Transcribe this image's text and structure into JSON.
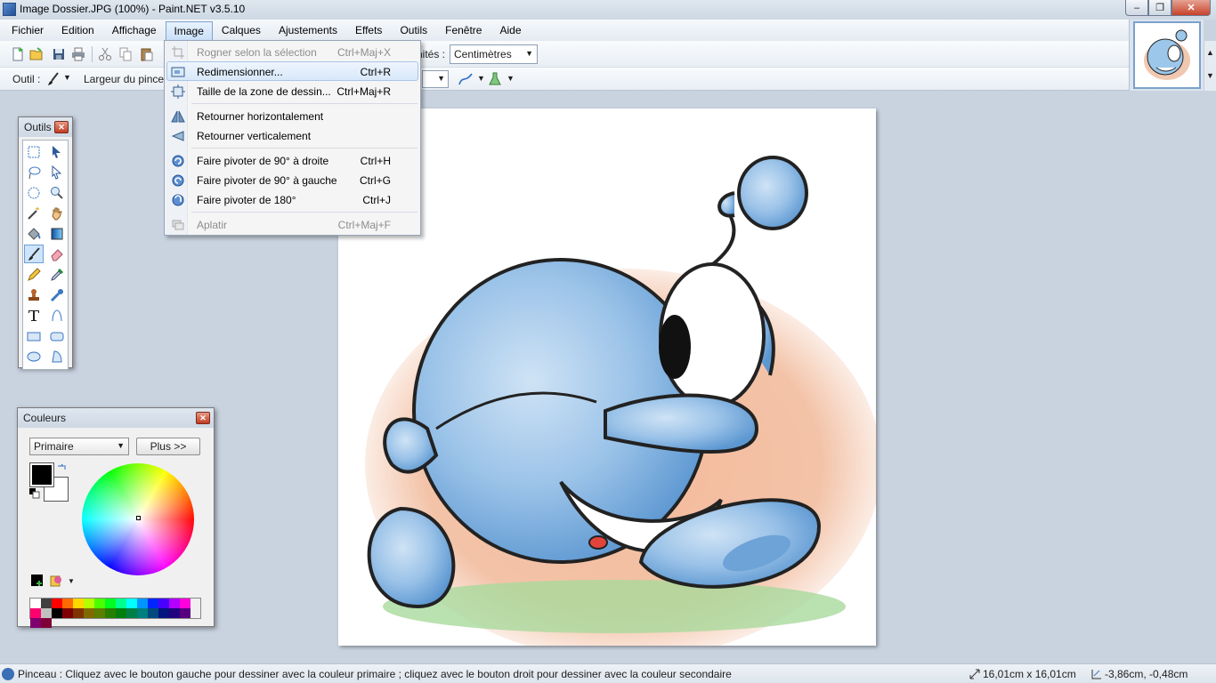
{
  "window": {
    "title": "Image Dossier.JPG (100%) - Paint.NET v3.5.10",
    "minimize_glyph": "–",
    "maximize_glyph": "❐",
    "close_glyph": "✕"
  },
  "menubar": [
    "Fichier",
    "Edition",
    "Affichage",
    "Image",
    "Calques",
    "Ajustements",
    "Effets",
    "Outils",
    "Fenêtre",
    "Aide"
  ],
  "toolbar": {
    "units_label": "nités :",
    "units_value": "Centimètres",
    "tool_label": "Outil :",
    "brush_width_label": "Largeur du pince"
  },
  "image_menu": {
    "items": [
      {
        "label": "Rogner selon la sélection",
        "shortcut": "Ctrl+Maj+X",
        "disabled": true,
        "icon": "crop-icon"
      },
      {
        "label": "Redimensionner...",
        "shortcut": "Ctrl+R",
        "hover": true,
        "icon": "resize-icon"
      },
      {
        "label": "Taille de la zone de dessin...",
        "shortcut": "Ctrl+Maj+R",
        "icon": "canvas-size-icon"
      },
      {
        "label": "Retourner horizontalement",
        "shortcut": "",
        "icon": "flip-horizontal-icon"
      },
      {
        "label": "Retourner verticalement",
        "shortcut": "",
        "icon": "flip-vertical-icon"
      },
      {
        "label": "Faire pivoter de 90° à droite",
        "shortcut": "Ctrl+H",
        "icon": "rotate-right-icon"
      },
      {
        "label": "Faire pivoter de 90° à gauche",
        "shortcut": "Ctrl+G",
        "icon": "rotate-left-icon"
      },
      {
        "label": "Faire pivoter de 180°",
        "shortcut": "Ctrl+J",
        "icon": "rotate-180-icon"
      },
      {
        "label": "Aplatir",
        "shortcut": "Ctrl+Maj+F",
        "disabled": true,
        "icon": "flatten-icon"
      }
    ]
  },
  "tools_panel": {
    "title": "Outils",
    "close_glyph": "✕",
    "tools": [
      "rectangle-select-icon",
      "move-selection-icon",
      "lasso-select-icon",
      "move-selected-icon",
      "ellipse-select-icon",
      "zoom-icon",
      "magic-wand-icon",
      "pan-icon",
      "paint-bucket-icon",
      "gradient-icon",
      "paintbrush-icon",
      "eraser-icon",
      "pencil-icon",
      "color-picker-icon",
      "clone-stamp-icon",
      "recolor-icon",
      "text-icon",
      "line-curve-icon",
      "rectangle-icon",
      "rounded-rectangle-icon",
      "ellipse-icon",
      "freeform-shape-icon"
    ],
    "selected_tool": "paintbrush-icon"
  },
  "colors_panel": {
    "title": "Couleurs",
    "close_glyph": "✕",
    "mode_value": "Primaire",
    "more_button": "Plus >>",
    "primary_color": "#000000",
    "secondary_color": "#ffffff",
    "palette": [
      "#ffffff",
      "#404040",
      "#ff0000",
      "#ff6a00",
      "#ffd800",
      "#b6ff00",
      "#4cff00",
      "#00ff21",
      "#00ff90",
      "#00ffff",
      "#0094ff",
      "#0026ff",
      "#4800ff",
      "#b200ff",
      "#ff00dc",
      "#ff006e",
      "#c0c0c0",
      "#000000",
      "#7f0000",
      "#7f3300",
      "#7f6a00",
      "#5b7f00",
      "#267f00",
      "#007f0e",
      "#007f46",
      "#007f7f",
      "#004a7f",
      "#00137f",
      "#21007f",
      "#57007f",
      "#7f006e",
      "#7f0037"
    ]
  },
  "statusbar": {
    "text": "Pinceau : Cliquez avec le bouton gauche pour dessiner avec la couleur primaire ; cliquez avec le bouton droit pour dessiner avec la couleur secondaire",
    "image_size": "16,01cm x 16,01cm",
    "cursor_position": "-3,86cm, -0,48cm"
  }
}
